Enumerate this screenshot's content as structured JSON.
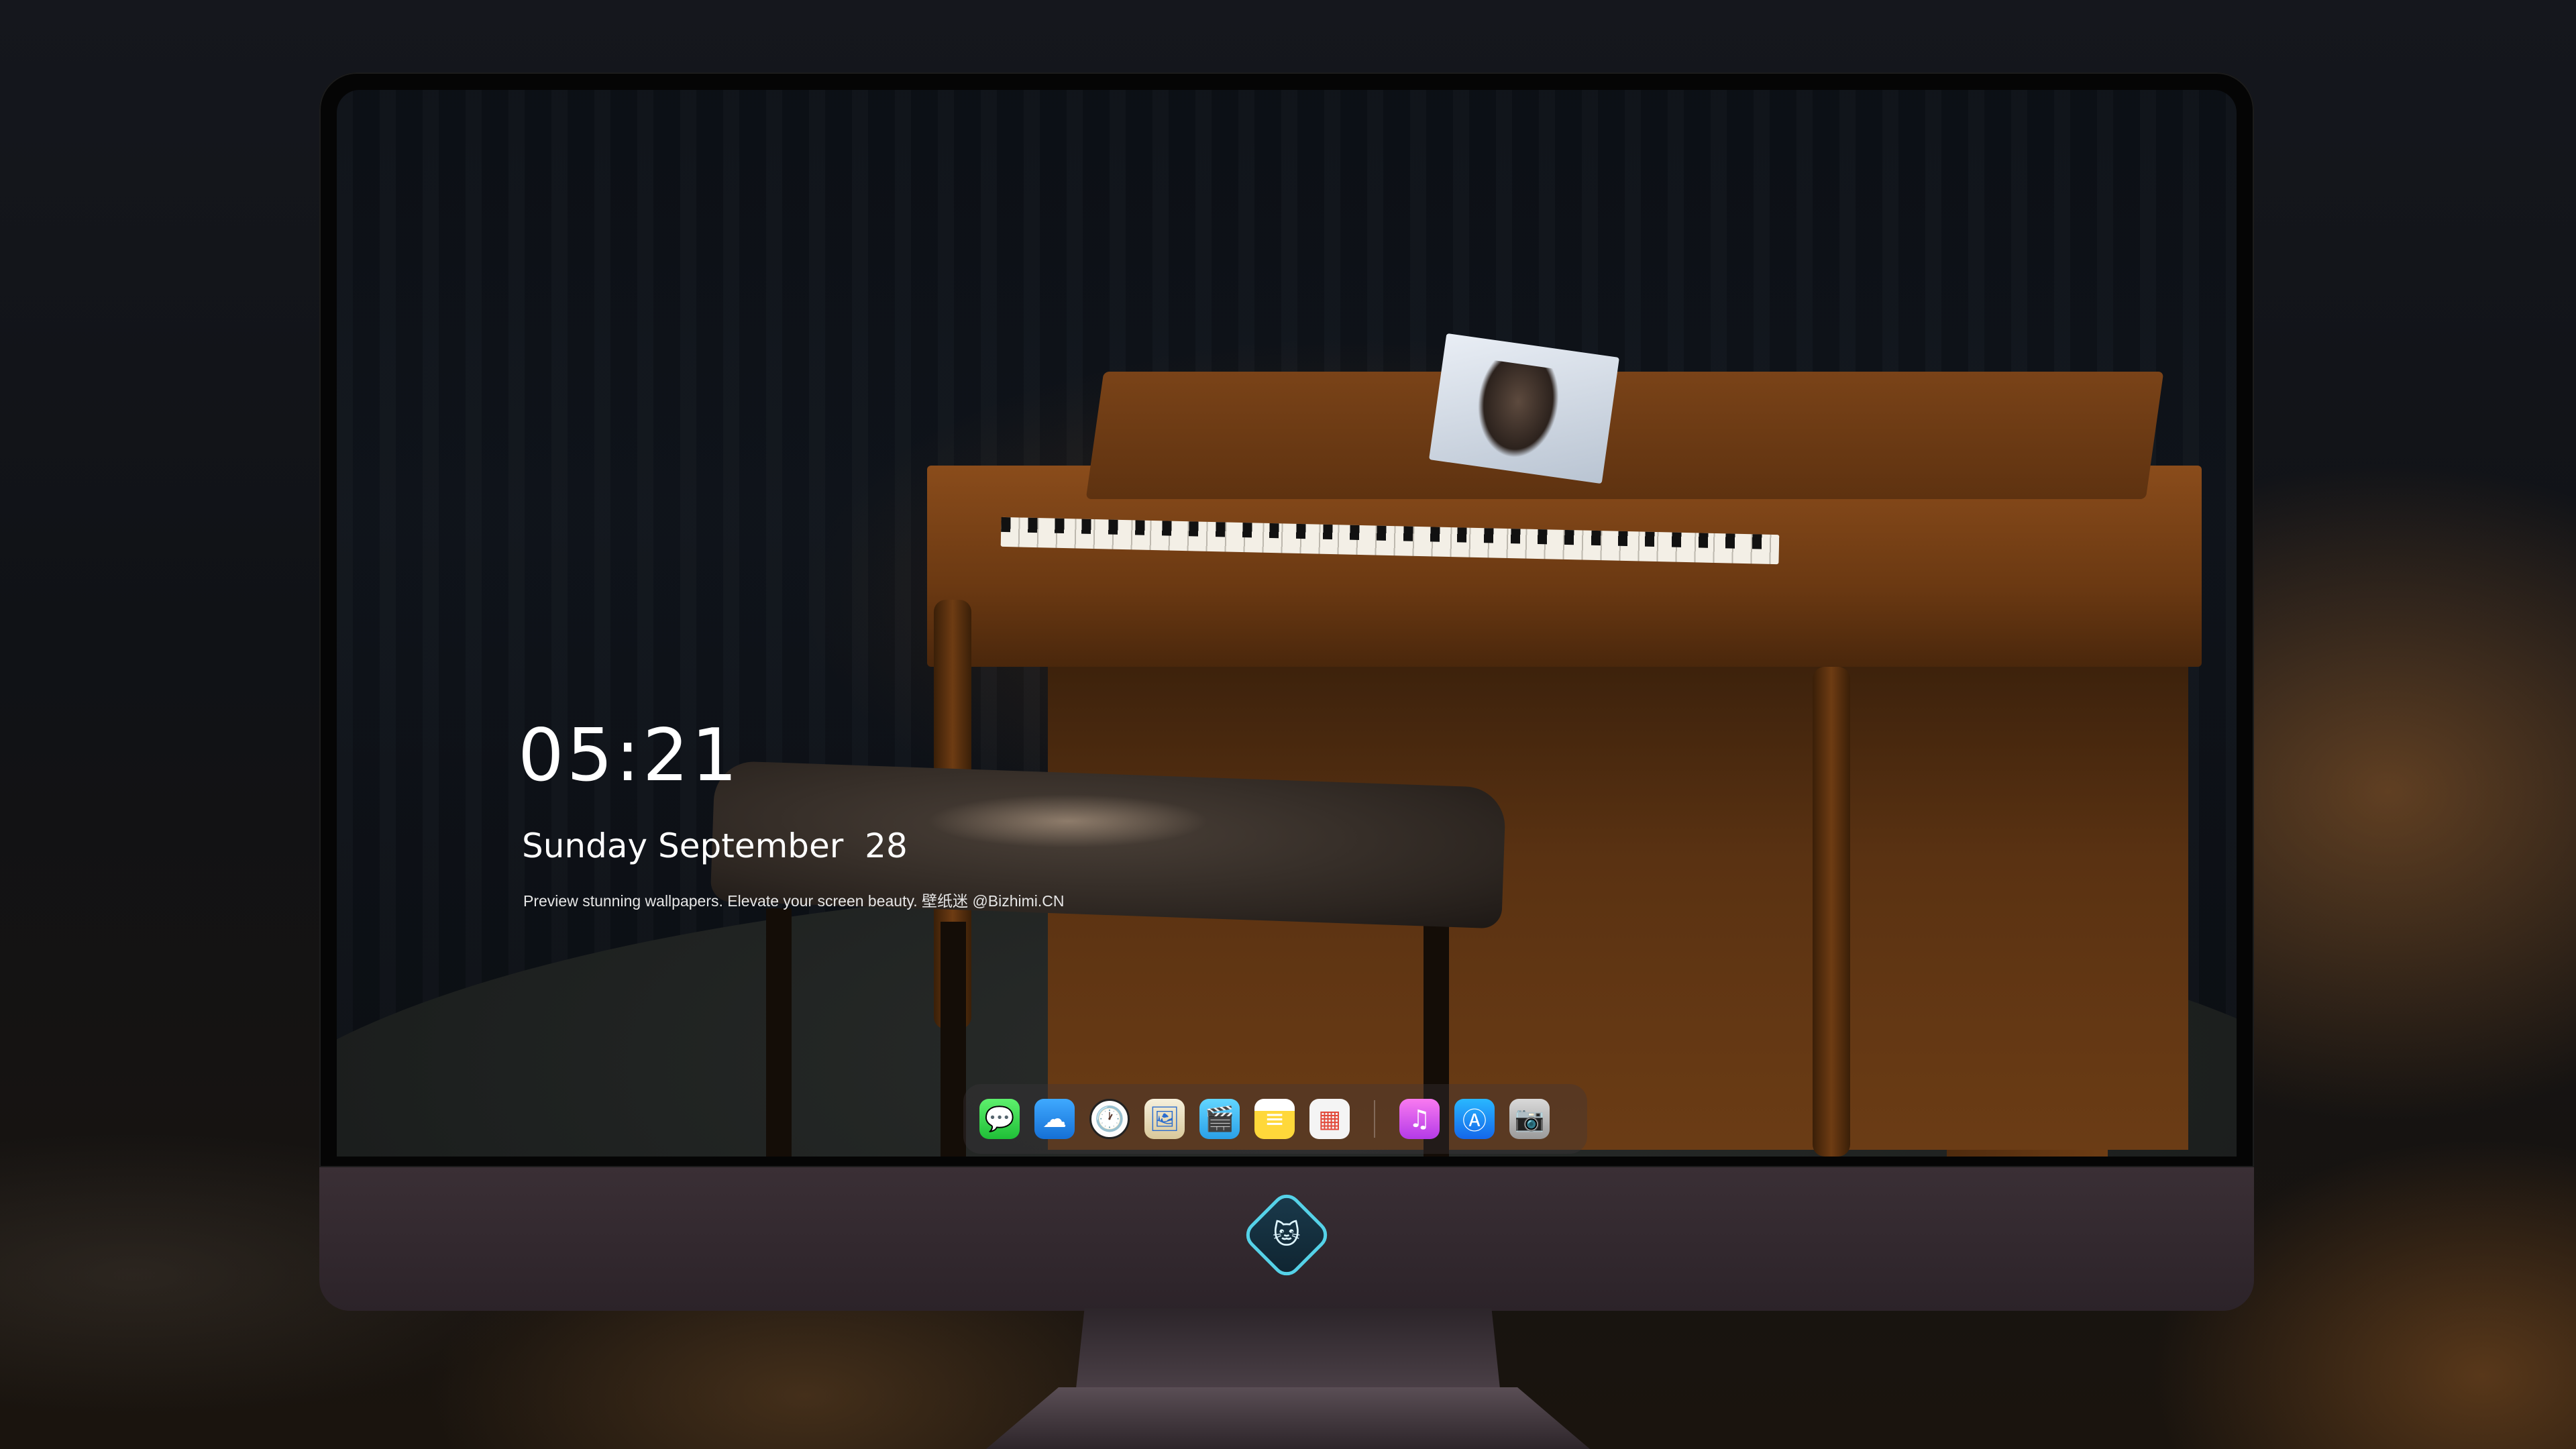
{
  "lockscreen": {
    "time": "05:21",
    "date": "Sunday September  28",
    "tagline": "Preview stunning wallpapers. Elevate your screen beauty. 壁纸迷 @Bizhimi.CN"
  },
  "dock": {
    "apps": [
      {
        "name": "messages",
        "glyph": "💬"
      },
      {
        "name": "weather",
        "glyph": "☁"
      },
      {
        "name": "clock",
        "glyph": "🕐"
      },
      {
        "name": "preview",
        "glyph": "🖼"
      },
      {
        "name": "clips",
        "glyph": "🎬"
      },
      {
        "name": "notes",
        "glyph": "≡"
      },
      {
        "name": "photos",
        "glyph": "▦"
      },
      {
        "name": "itunes",
        "glyph": "♫"
      },
      {
        "name": "app-store",
        "glyph": "Ⓐ"
      },
      {
        "name": "camera",
        "glyph": "📷"
      }
    ]
  },
  "brand": {
    "logo_glyph": "🐱"
  },
  "colors": {
    "chin": "#3a2f35",
    "bezel": "#050505",
    "text": "#ffffff"
  }
}
